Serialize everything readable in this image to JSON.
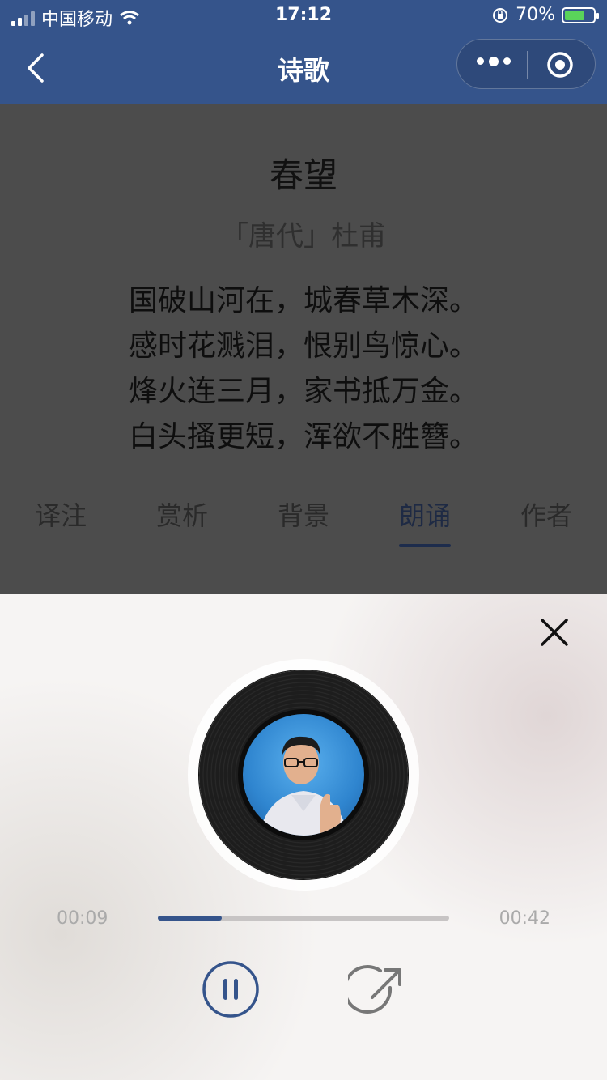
{
  "status": {
    "carrier": "中国移动",
    "time": "17:12",
    "battery": "70%",
    "battery_level": 0.7
  },
  "nav": {
    "title": "诗歌"
  },
  "poem": {
    "title": "春望",
    "author": "「唐代」杜甫",
    "lines": [
      "国破山河在，城春草木深。",
      "感时花溅泪，恨别鸟惊心。",
      "烽火连三月，家书抵万金。",
      "白头搔更短，浑欲不胜簪。"
    ]
  },
  "tabs": [
    "译注",
    "赏析",
    "背景",
    "朗诵",
    "作者"
  ],
  "active_tab": "朗诵",
  "player": {
    "current_time": "00:09",
    "total_time": "00:42",
    "progress": 0.22
  },
  "colors": {
    "nav": "#35548b",
    "accent": "#35548b"
  }
}
